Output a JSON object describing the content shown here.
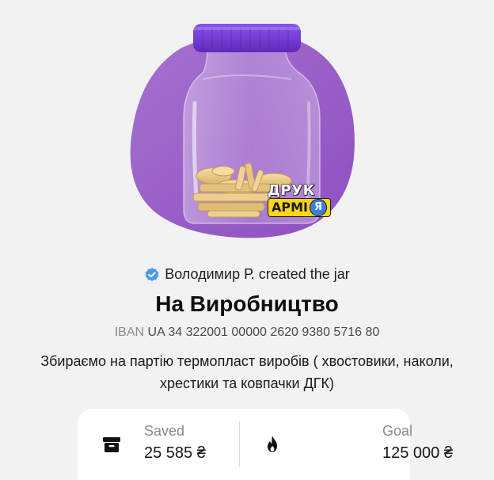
{
  "badge": {
    "top_text": "ДРУК",
    "bottom_text": "АРМІ",
    "bottom_letter": "Я"
  },
  "creator": {
    "icon": "verified-check-icon",
    "text": "Володимир Р. created the jar"
  },
  "jar": {
    "title": "На Виробництво",
    "iban_label": "IBAN",
    "iban_value": "UA 34 322001 00000 2620 9380 5716 80",
    "description": "Збираємо на партію термопласт виробів ( хвостовики, наколи, хрестики та ковпачки ДГК)"
  },
  "stats": {
    "saved": {
      "label": "Saved",
      "value": "25 585 ₴",
      "icon": "archive-box-icon"
    },
    "goal": {
      "label": "Goal",
      "value": "125 000 ₴",
      "icon": "flame-icon"
    }
  },
  "colors": {
    "background": "#f2f2f2",
    "blob": "#9a5dc6",
    "lid": "#7b3fe0",
    "verified": "#4a9ae8"
  }
}
